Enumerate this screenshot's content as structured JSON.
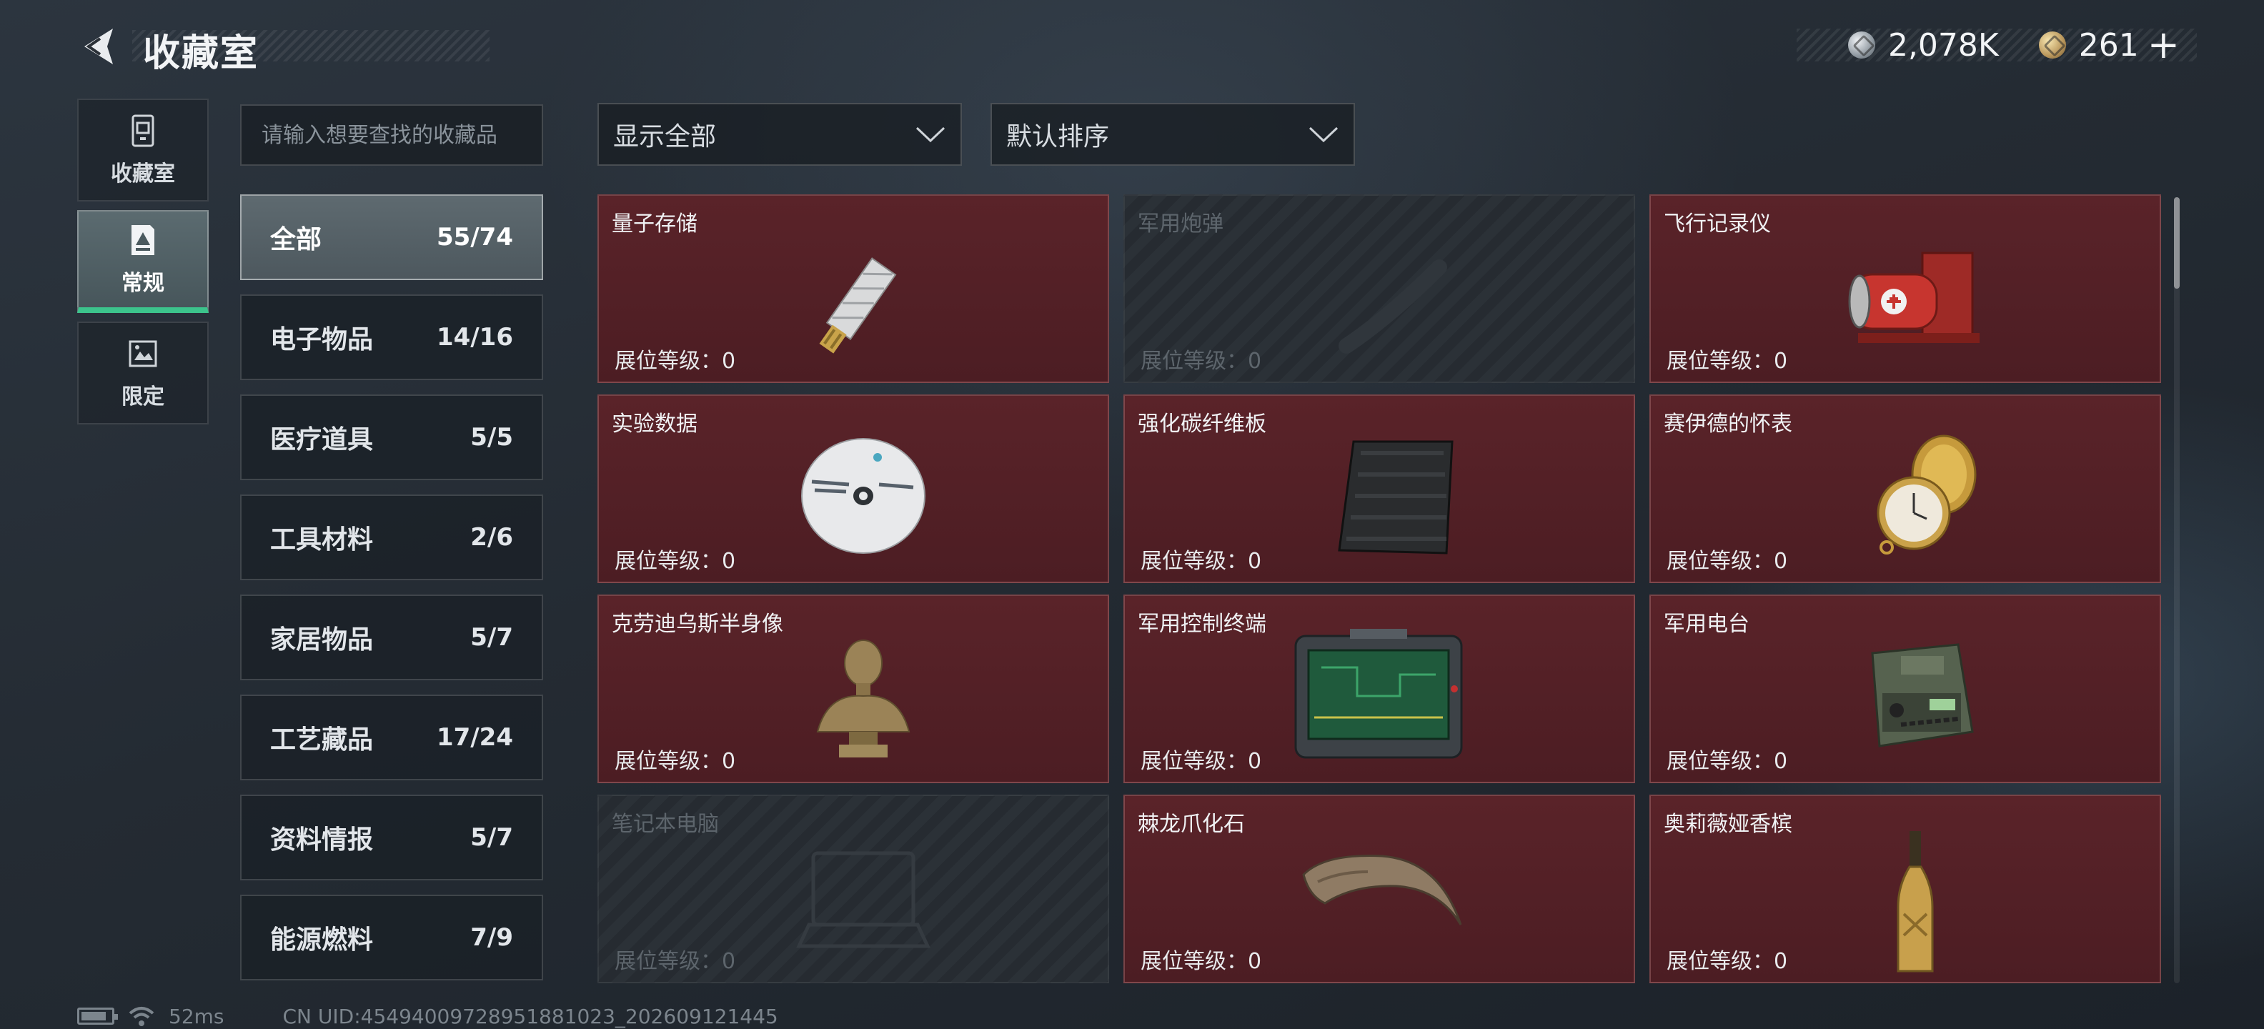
{
  "header": {
    "title": "收藏室",
    "currency": [
      {
        "icon": "silver-coin-icon",
        "value": "2,078K"
      },
      {
        "icon": "gold-coin-icon",
        "value": "261"
      }
    ],
    "add_label": "+"
  },
  "left_tabs": [
    {
      "label": "收藏室",
      "icon": "vault-icon"
    },
    {
      "label": "常规",
      "icon": "regular-collection-icon"
    },
    {
      "label": "限定",
      "icon": "limited-collection-icon"
    }
  ],
  "search": {
    "placeholder": "请输入想要查找的收藏品"
  },
  "categories": [
    {
      "name": "全部",
      "count": "55/74"
    },
    {
      "name": "电子物品",
      "count": "14/16"
    },
    {
      "name": "医疗道具",
      "count": "5/5"
    },
    {
      "name": "工具材料",
      "count": "2/6"
    },
    {
      "name": "家居物品",
      "count": "5/7"
    },
    {
      "name": "工艺藏品",
      "count": "17/24"
    },
    {
      "name": "资料情报",
      "count": "5/7"
    },
    {
      "name": "能源燃料",
      "count": "7/9"
    }
  ],
  "filters": {
    "display": "显示全部",
    "sort": "默认排序"
  },
  "level_label": "展位等级：0",
  "items": [
    {
      "name": "量子存储",
      "owned": true,
      "icon": "usb-drive-icon"
    },
    {
      "name": "军用炮弹",
      "owned": false,
      "icon": "shell-icon"
    },
    {
      "name": "飞行记录仪",
      "owned": true,
      "icon": "flight-recorder-icon"
    },
    {
      "name": "实验数据",
      "owned": true,
      "icon": "disc-icon"
    },
    {
      "name": "强化碳纤维板",
      "owned": true,
      "icon": "carbon-plate-icon"
    },
    {
      "name": "赛伊德的怀表",
      "owned": true,
      "icon": "pocket-watch-icon"
    },
    {
      "name": "克劳迪乌斯半身像",
      "owned": true,
      "icon": "bust-icon"
    },
    {
      "name": "军用控制终端",
      "owned": true,
      "icon": "control-terminal-icon"
    },
    {
      "name": "军用电台",
      "owned": true,
      "icon": "radio-icon"
    },
    {
      "name": "笔记本电脑",
      "owned": false,
      "icon": "laptop-icon"
    },
    {
      "name": "棘龙爪化石",
      "owned": true,
      "icon": "claw-fossil-icon"
    },
    {
      "name": "奥莉薇娅香槟",
      "owned": true,
      "icon": "champagne-icon"
    }
  ],
  "status": {
    "ping": "52ms",
    "uid": "CN UID:45494009728951881023_202609121445"
  },
  "colors": {
    "owned_card": "#4f1e24",
    "active_tab_accent": "#3cc48c"
  }
}
